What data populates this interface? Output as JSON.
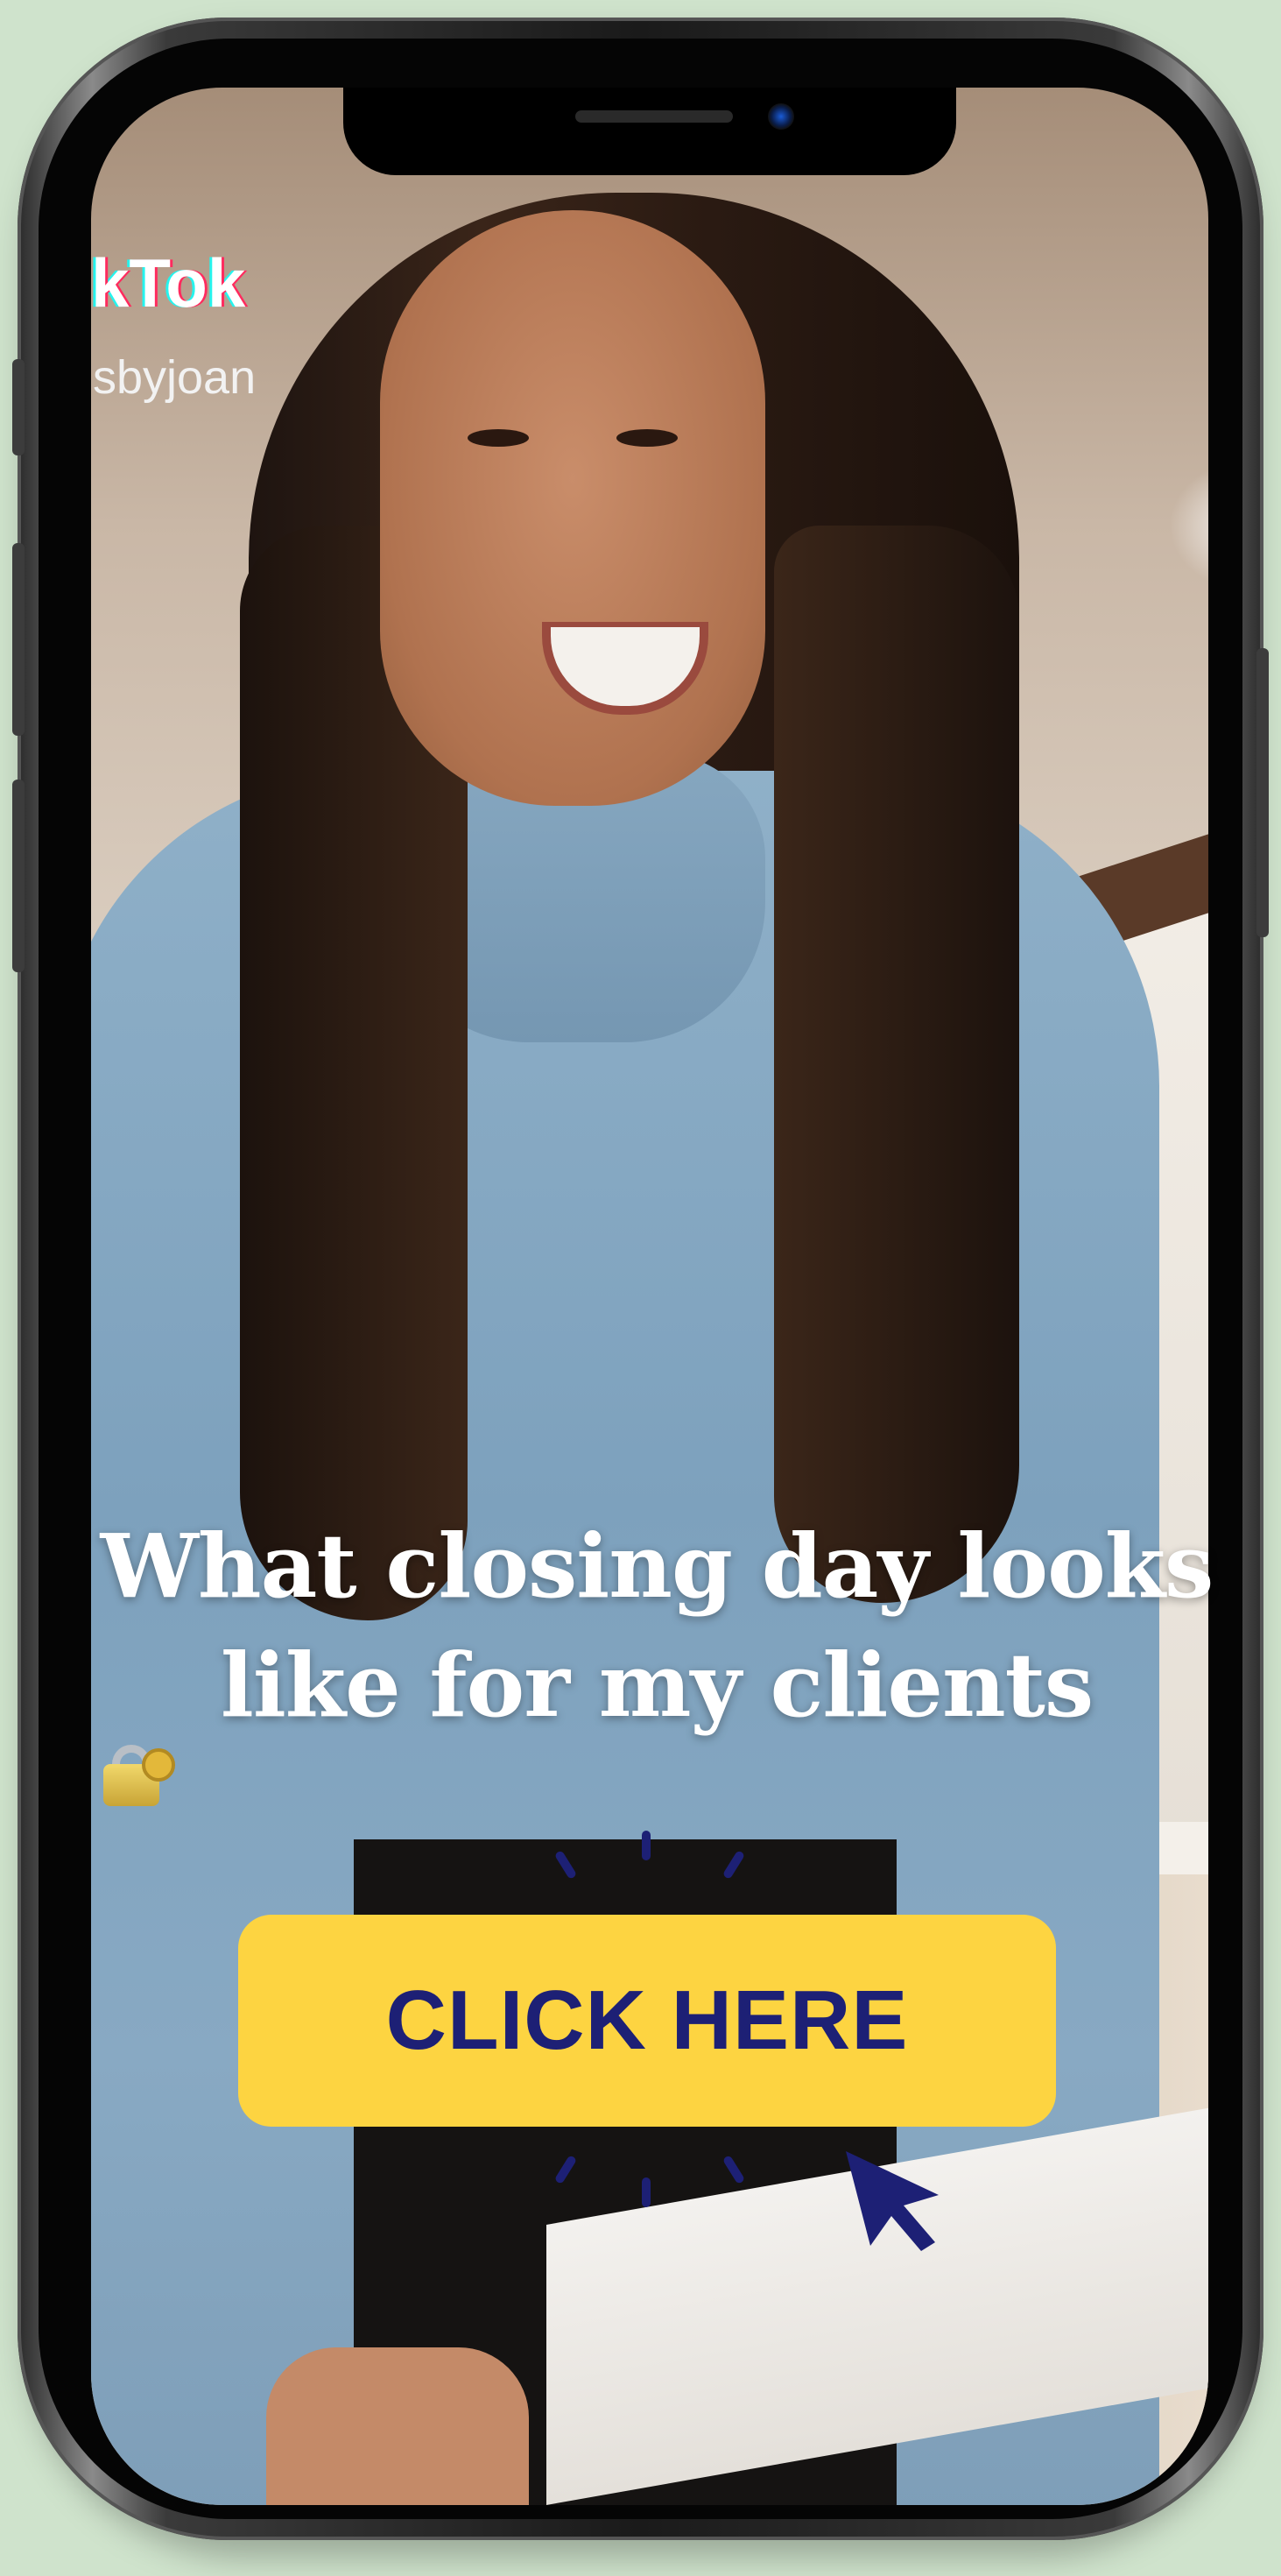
{
  "status": {
    "app_logo": "kTok",
    "username": "sbyjoan"
  },
  "video": {
    "caption_line1": "What closing day looks",
    "caption_line2": "like for my clients",
    "caption_emoji": "lock-with-key-icon"
  },
  "cta": {
    "label": "CLICK HERE",
    "button_color": "#fdd441",
    "text_color": "#1d2075"
  },
  "icons": {
    "cursor": "mouse-pointer-icon",
    "rays": "click-burst-icon"
  },
  "colors": {
    "background": "#cfe3cc",
    "phone_frame": "#1a1a1a"
  }
}
